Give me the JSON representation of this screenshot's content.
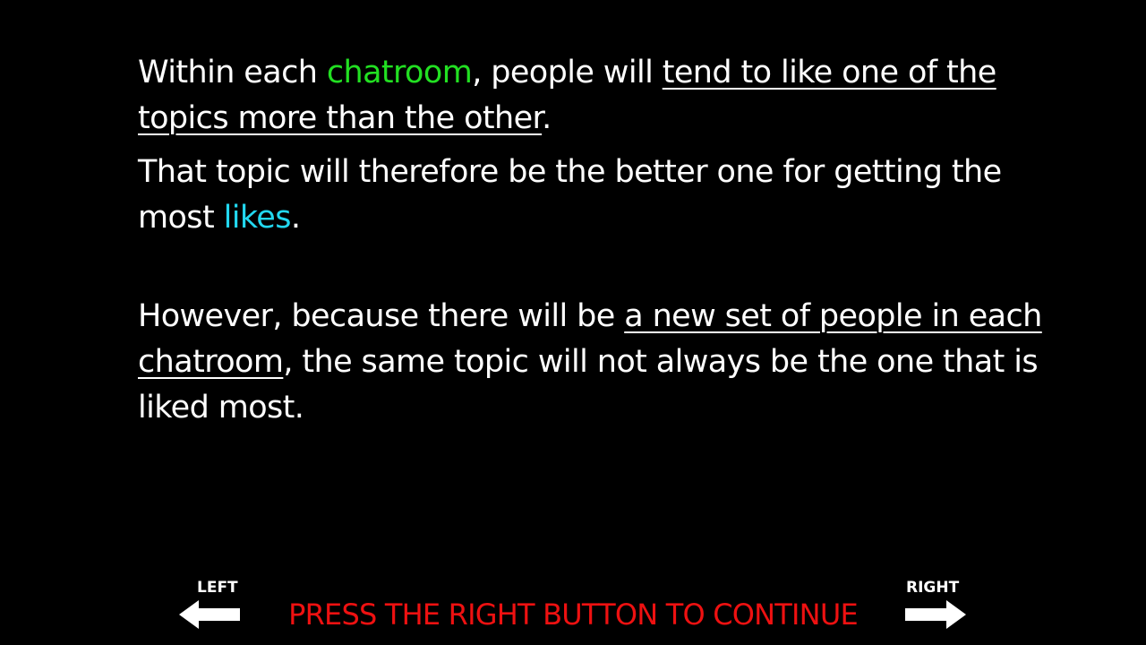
{
  "slide": {
    "paragraph1": {
      "part1": "Within each ",
      "chatroom_word": "chatroom",
      "part2": ", people will ",
      "underlined": "tend to like one of the topics more than the other",
      "end": "."
    },
    "paragraph2": {
      "part1": "That topic will therefore be the better one for getting the most ",
      "likes_word": "likes",
      "end": "."
    },
    "paragraph3": {
      "part1": "However, because there will be ",
      "underlined": "a new set of people in each chatroom",
      "part2": ", the same topic will not always be the one that is liked most."
    }
  },
  "footer": {
    "left_label": "LEFT",
    "right_label": "RIGHT",
    "instruction": "PRESS THE RIGHT BUTTON TO CONTINUE",
    "left_icon": "arrow-left-icon",
    "right_icon": "arrow-right-icon"
  },
  "colors": {
    "background": "#000000",
    "text": "#ffffff",
    "chatroom": "#22e022",
    "likes": "#22d8f0",
    "instruction": "#ee1111"
  }
}
